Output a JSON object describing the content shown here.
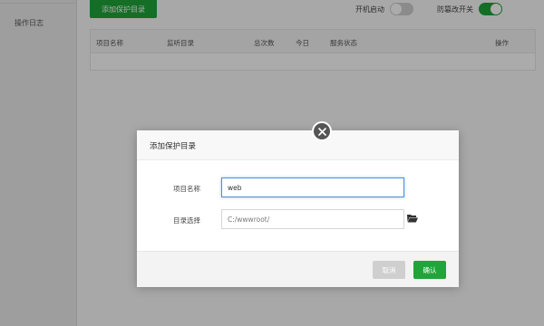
{
  "sidebar": {
    "items": [
      {
        "label": "操作日志"
      }
    ]
  },
  "toolbar": {
    "add_button_label": "添加保护目录",
    "startup_label": "开机启动",
    "startup_enabled": false,
    "tamper_label": "防篡改开关",
    "tamper_enabled": true
  },
  "table": {
    "columns": [
      "项目名称",
      "监听目录",
      "总次数",
      "今日",
      "服务状态",
      "操作"
    ],
    "rows": []
  },
  "dialog": {
    "title": "添加保护目录",
    "name_label": "项目名称",
    "name_value": "web",
    "dir_label": "目录选择",
    "dir_value": "C:/wwwroot/",
    "cancel_label": "取消",
    "confirm_label": "确认"
  },
  "colors": {
    "accent": "#20a53a",
    "overlay": "rgba(0,0,0,0.33)"
  },
  "icons": {
    "close": "close-icon",
    "folder": "folder-open-icon"
  }
}
